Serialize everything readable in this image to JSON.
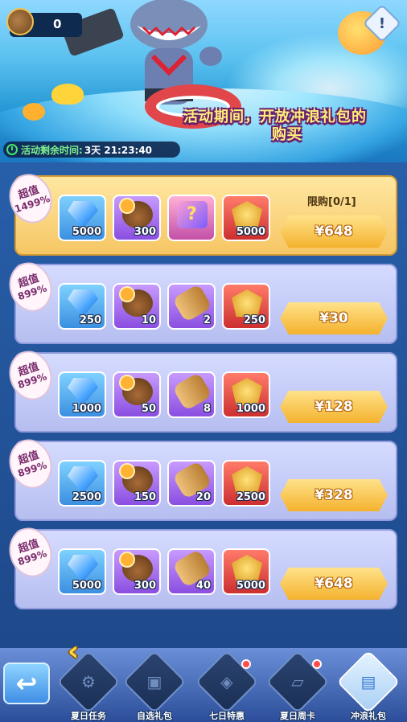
{
  "header": {
    "currency_value": "0",
    "currency_icon": "coconut-drink-icon",
    "info_icon": "exclamation-icon",
    "headline_line1": "活动期间，开放冲浪礼包的",
    "headline_line2": "购买",
    "timer_label": "活动剩余时间:",
    "timer_value": "3天 21:23:40"
  },
  "packs": [
    {
      "badge_top": "超值",
      "badge_bottom": "1499%",
      "limit": "限购[0/1]",
      "price": "¥648",
      "items": [
        {
          "icon": "diamond-icon",
          "qty": "5000"
        },
        {
          "icon": "coconut-drink-icon",
          "qty": "300"
        },
        {
          "icon": "mystery-card-icon",
          "qty": ""
        },
        {
          "icon": "gold-crest-icon",
          "qty": "5000"
        }
      ]
    },
    {
      "badge_top": "超值",
      "badge_bottom": "899%",
      "price": "¥30",
      "items": [
        {
          "icon": "diamond-icon",
          "qty": "250"
        },
        {
          "icon": "coconut-drink-icon",
          "qty": "10"
        },
        {
          "icon": "telescope-icon",
          "qty": "2"
        },
        {
          "icon": "gold-crest-icon",
          "qty": "250"
        }
      ]
    },
    {
      "badge_top": "超值",
      "badge_bottom": "899%",
      "price": "¥128",
      "items": [
        {
          "icon": "diamond-icon",
          "qty": "1000"
        },
        {
          "icon": "coconut-drink-icon",
          "qty": "50"
        },
        {
          "icon": "telescope-icon",
          "qty": "8"
        },
        {
          "icon": "gold-crest-icon",
          "qty": "1000"
        }
      ]
    },
    {
      "badge_top": "超值",
      "badge_bottom": "899%",
      "price": "¥328",
      "items": [
        {
          "icon": "diamond-icon",
          "qty": "2500"
        },
        {
          "icon": "coconut-drink-icon",
          "qty": "150"
        },
        {
          "icon": "telescope-icon",
          "qty": "20"
        },
        {
          "icon": "gold-crest-icon",
          "qty": "2500"
        }
      ]
    },
    {
      "badge_top": "超值",
      "badge_bottom": "899%",
      "price": "¥648",
      "items": [
        {
          "icon": "diamond-icon",
          "qty": "5000"
        },
        {
          "icon": "coconut-drink-icon",
          "qty": "300"
        },
        {
          "icon": "telescope-icon",
          "qty": "40"
        },
        {
          "icon": "gold-crest-icon",
          "qty": "5000"
        }
      ]
    }
  ],
  "nav": {
    "back_icon": "back-arrow-icon",
    "tabs": [
      {
        "label": "夏日任务",
        "icon": "task-icon",
        "dot": false,
        "active": false
      },
      {
        "label": "自选礼包",
        "icon": "gift-box-icon",
        "dot": false,
        "active": false
      },
      {
        "label": "七日特惠",
        "icon": "gift-bag-icon",
        "dot": true,
        "active": false
      },
      {
        "label": "夏日周卡",
        "icon": "ticket-icon",
        "dot": true,
        "active": false
      },
      {
        "label": "冲浪礼包",
        "icon": "surf-gift-icon",
        "dot": false,
        "active": true
      }
    ]
  },
  "colors": {
    "gold_pack": "#f6c664",
    "normal_pack": "#b6bef0",
    "buy_button": "#f4b22e",
    "timer_text": "#7ff08e"
  }
}
